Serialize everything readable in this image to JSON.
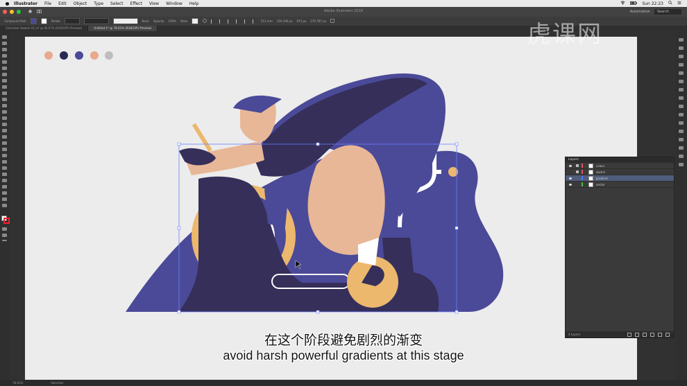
{
  "menubar": {
    "app_name": "Illustrator",
    "menus": [
      "File",
      "Edit",
      "Object",
      "Type",
      "Select",
      "Effect",
      "View",
      "Window",
      "Help"
    ],
    "clock": "Sun 22:23"
  },
  "window": {
    "title": "Adobe Illustrator 2019",
    "workspace": "Automation",
    "search_placeholder": "Search"
  },
  "properties_bar": {
    "selection_label": "Compound Path",
    "stroke_label": "Stroke",
    "opacity_label": "Opacity",
    "opacity_value": "100%",
    "style_label": "Style",
    "basic_label": "Basic",
    "x_value": "512 mm",
    "y_value": "194.106 px",
    "w_value": "973 px",
    "h_value": "270.787 px"
  },
  "tabs": [
    {
      "label": "Character Swatch 01.ai* @ 66.67% (RGB/GPU Preview)"
    },
    {
      "label": "Untitled-1* @ 78.61% (RGB/GPU Preview)"
    }
  ],
  "palette_swatches": [
    "#e8a98c",
    "#2b2a52",
    "#4b4a98",
    "#e8a98c",
    "#bdbdbd"
  ],
  "colors": {
    "ground": "#4b4a98",
    "bike_dark": "#352f5a",
    "skin": "#e8b797",
    "wheel": "#ecb86e",
    "shirt": "#4b4a98",
    "white": "#ffffff",
    "accent_selection": "#6b7fff"
  },
  "layers_panel": {
    "title": "Layers",
    "layers": [
      {
        "name": "colour",
        "color": "#e05555"
      },
      {
        "name": "sketch",
        "color": "#e05555"
      },
      {
        "name": "gradient",
        "color": "#4a7cff"
      },
      {
        "name": "vector",
        "color": "#43c843"
      }
    ],
    "footer": "4 Layers"
  },
  "status": {
    "zoom": "78.61%",
    "tool": "Selection"
  },
  "subtitles": {
    "cn": "在这个阶段避免剧烈的渐变",
    "en": "avoid harsh powerful gradients at this stage"
  },
  "watermark": "虎课网"
}
